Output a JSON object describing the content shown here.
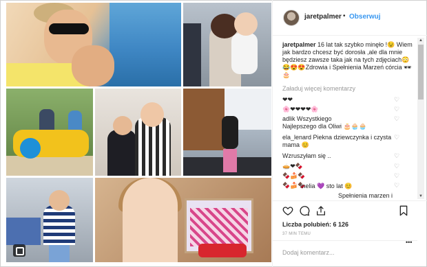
{
  "header": {
    "username": "jaretpalmer",
    "separator": "•",
    "follow_label": "Obserwuj"
  },
  "caption": {
    "username": "jaretpalmer",
    "text": "16 lat tak szybko minęło !😉 Wiem jak bardzo chcesz być dorosła ,ale dla mnie będziesz zawsze taka jak na tych zdjęciach😳😂😍😍Zdrowia i Spełnienia Marzeń córcia 🕶🎂"
  },
  "load_more": "Załaduj więcej komentarzy",
  "comments": [
    {
      "text": "❤❤"
    },
    {
      "text": "🌸❤❤❤❤🌸"
    },
    {
      "text": "adlik Wszystkiego"
    },
    {
      "text": "Najlepszego dla Oliwi 🎂🧁🧁"
    },
    {
      "text": "ela_lenard Piekna dziewczynka i czysta"
    },
    {
      "text": "mama 😊"
    },
    {
      "text": "Wzruszyłam się .."
    },
    {
      "text": "🥧❤🍫"
    },
    {
      "text": "🍫🍰🍫"
    },
    {
      "text": "🍫🍰🍫"
    },
    {
      "text": "melia 💜 sto lat 😊"
    },
    {
      "text": "Spełnienia marzen i"
    }
  ],
  "likes": "Liczba polubień: 6 126",
  "time": "37 MIN TEMU",
  "add_comment_placeholder": "Dodaj komentarz...",
  "more_dots": "•••",
  "icons": {
    "like": "heart-outline-icon",
    "comment": "comment-bubble-icon",
    "share": "share-arrow-icon",
    "save": "bookmark-icon",
    "multi": "multiple-photos-icon"
  }
}
